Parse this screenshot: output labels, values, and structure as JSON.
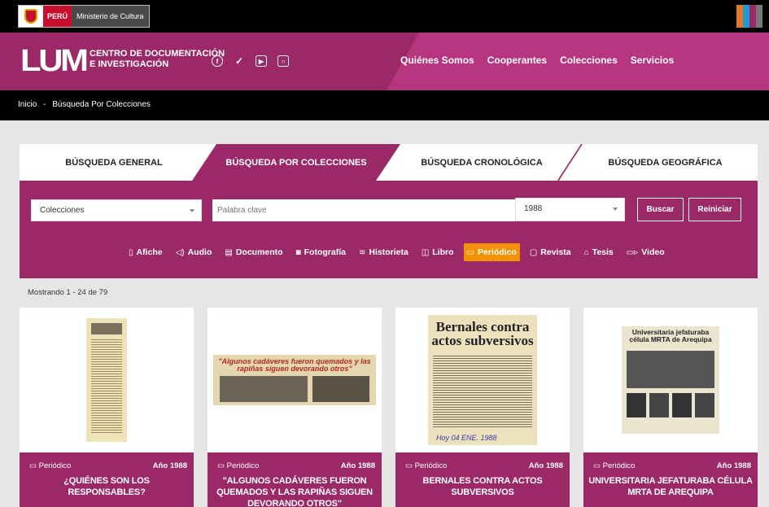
{
  "gov": {
    "peru": "PERÚ",
    "ministry": "Ministerio de Cultura"
  },
  "brand": {
    "logo": "LUM",
    "line1": "CENTRO DE DOCUMENTACIÓN",
    "line2": "E INVESTIGACIÓN"
  },
  "socials": [
    "facebook-icon",
    "twitter-icon",
    "youtube-icon",
    "instagram-icon"
  ],
  "nav": [
    "Quiénes Somos",
    "Cooperantes",
    "Colecciones",
    "Servicios"
  ],
  "breadcrumb": {
    "home": "Inicio",
    "sep": "-",
    "current": "Búsqueda Por Colecciones"
  },
  "tabs": [
    "BÚSQUEDA GENERAL",
    "BÚSQUEDA POR COLECCIONES",
    "BÚSQUEDA CRONOLÓGICA",
    "BÚSQUEDA GEOGRÁFICA"
  ],
  "filters": {
    "collection": "Colecciones",
    "keyword_placeholder": "Palabra clave",
    "year": "1988",
    "search": "Buscar",
    "reset": "Reiniciar"
  },
  "types": [
    {
      "label": "Afiche",
      "icon": "poster-icon"
    },
    {
      "label": "Audio",
      "icon": "audio-icon"
    },
    {
      "label": "Documento",
      "icon": "document-icon"
    },
    {
      "label": "Fotografía",
      "icon": "camera-icon"
    },
    {
      "label": "Historieta",
      "icon": "comic-icon"
    },
    {
      "label": "Libro",
      "icon": "book-icon"
    },
    {
      "label": "Periódico",
      "icon": "newspaper-icon",
      "active": true
    },
    {
      "label": "Revista",
      "icon": "magazine-icon"
    },
    {
      "label": "Tesis",
      "icon": "graduation-icon"
    },
    {
      "label": "Video",
      "icon": "video-icon"
    }
  ],
  "showing": "Mostrando 1 - 24 de 79",
  "cards": [
    {
      "type": "Periódico",
      "year": "Año 1988",
      "title": "¿QUIÉNES SON LOS RESPONSABLES?"
    },
    {
      "type": "Periódico",
      "year": "Año 1988",
      "title": "\"ALGUNOS CADÁVERES FUERON QUEMADOS Y LAS RAPIÑAS SIGUEN DEVORANDO OTROS\"",
      "clip_headline": "\"Algunos cadáveres fueron quemados y las rapiñas siguen devorando otros\""
    },
    {
      "type": "Periódico",
      "year": "Año 1988",
      "title": "BERNALES CONTRA ACTOS SUBVERSIVOS",
      "clip_headline": "Bernales contra actos subversivos",
      "clip_note": "Hoy 04 ENE. 1988"
    },
    {
      "type": "Periódico",
      "year": "Año 1988",
      "title": "UNIVERSITARIA JEFATURABA CÉLULA MRTA DE AREQUIPA",
      "clip_headline": "Universitaria jefaturaba célula MRTA de Arequipa"
    }
  ],
  "colors": {
    "primary": "#9b2968",
    "accent": "#f29200",
    "nav_bg": "#b6377f"
  }
}
